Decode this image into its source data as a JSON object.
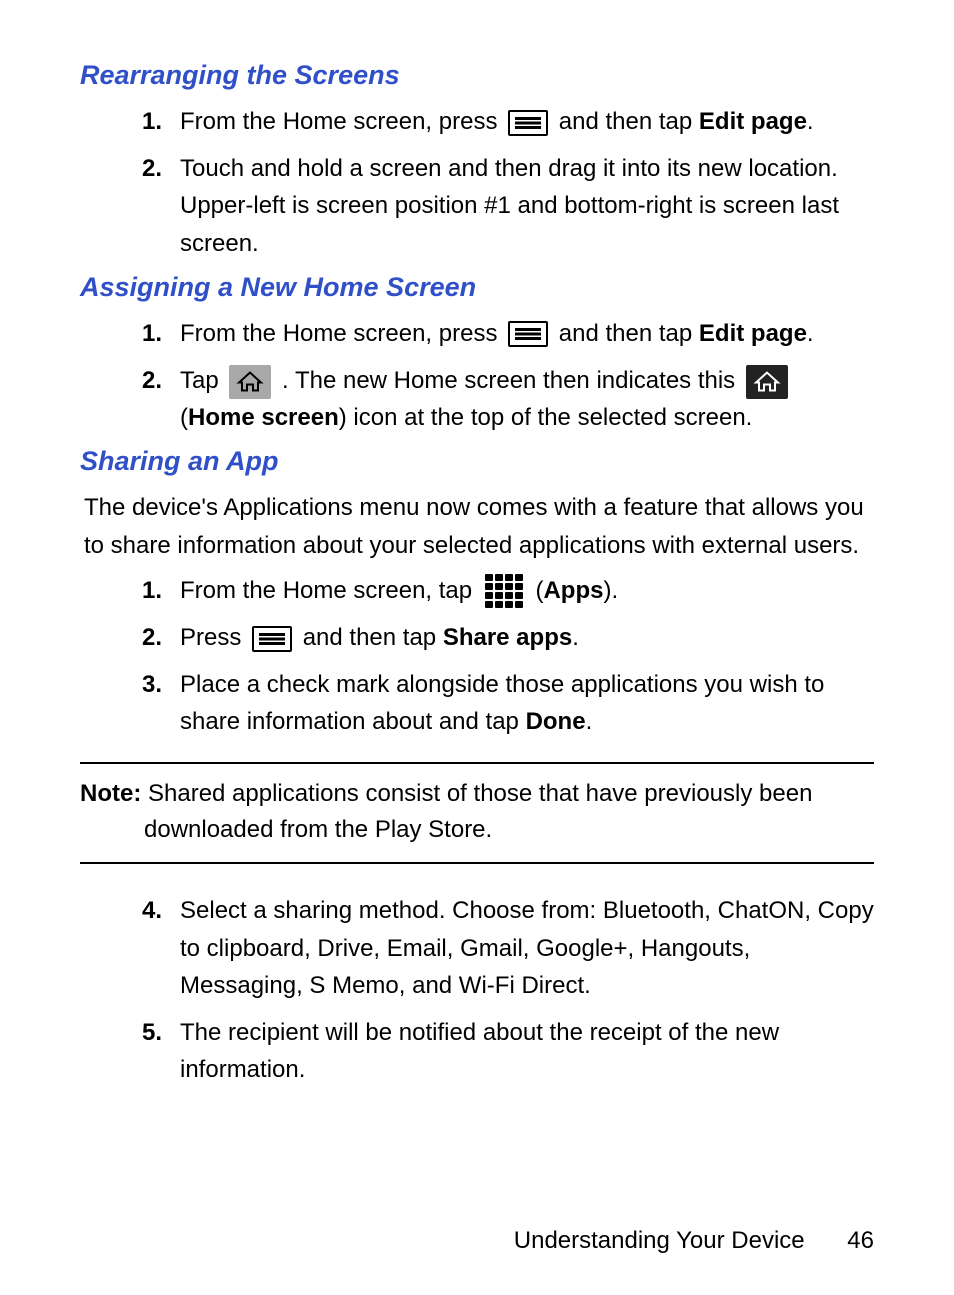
{
  "sections": {
    "rearranging": {
      "title": "Rearranging the Screens",
      "items": [
        {
          "num": "1.",
          "pre": "From the Home screen, press ",
          "post": " and then tap ",
          "bold_post": "Edit page",
          "tail": "."
        },
        {
          "num": "2.",
          "text": "Touch and hold a screen and then drag it into its new location. Upper-left is screen position #1 and bottom-right is screen last screen."
        }
      ]
    },
    "assigning": {
      "title": "Assigning a New Home Screen",
      "items": [
        {
          "num": "1.",
          "pre": "From the Home screen, press ",
          "post": " and then tap ",
          "bold_post": "Edit page",
          "tail": "."
        },
        {
          "num": "2.",
          "pre": "Tap ",
          "mid": ". The new Home screen then indicates this ",
          "line2a": "(",
          "bold_line2": "Home screen",
          "line2b": ") icon at the top of the selected screen."
        }
      ]
    },
    "sharing": {
      "title": "Sharing an App",
      "intro": "The device's Applications menu now comes with a feature that allows you to share information about your selected applications with external users.",
      "items": [
        {
          "num": "1.",
          "pre": "From the Home screen, tap ",
          "paren_open": " (",
          "bold": "Apps",
          "paren_close": ")."
        },
        {
          "num": "2.",
          "pre": "Press ",
          "post": " and then tap ",
          "bold_post": "Share apps",
          "tail": "."
        },
        {
          "num": "3.",
          "pre": "Place a check mark alongside those applications you wish to share information about and tap ",
          "bold": "Done",
          "tail": "."
        },
        {
          "num": "4.",
          "text": "Select a sharing method. Choose from: Bluetooth, ChatON, Copy to clipboard, Drive, Email, Gmail, Google+, Hangouts, Messaging, S Memo, and Wi-Fi Direct."
        },
        {
          "num": "5.",
          "text": "The recipient will be notified about the receipt of the new information."
        }
      ],
      "note_label": "Note:",
      "note_body": " Shared applications consist of those that have previously been downloaded from the Play Store."
    }
  },
  "footer": {
    "chapter": "Understanding Your Device",
    "page": "46"
  }
}
